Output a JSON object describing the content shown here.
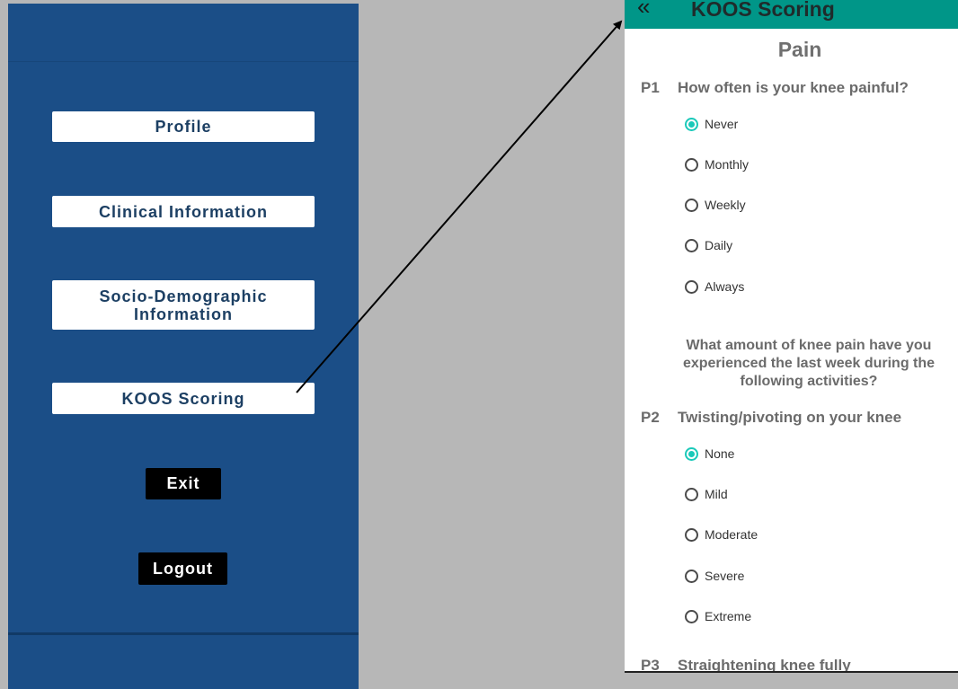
{
  "menu": {
    "profile": "Profile",
    "clinical": "Clinical Information",
    "socio_line1": "Socio-Demographic",
    "socio_line2": "Information",
    "koos": "KOOS Scoring",
    "exit": "Exit",
    "logout": "Logout"
  },
  "koos": {
    "back_icon": "«",
    "title": "KOOS Scoring",
    "section": "Pain",
    "p1": {
      "num": "P1",
      "question": "How often is your knee painful?",
      "options": [
        "Never",
        "Monthly",
        "Weekly",
        "Daily",
        "Always"
      ],
      "selected": "Never"
    },
    "instruction": "What amount of knee pain have you experienced the last week during the following activities?",
    "p2": {
      "num": "P2",
      "question": "Twisting/pivoting on your knee",
      "options": [
        "None",
        "Mild",
        "Moderate",
        "Severe",
        "Extreme"
      ],
      "selected": "None"
    },
    "p3": {
      "num": "P3",
      "question": "Straightening knee fully"
    }
  },
  "colors": {
    "menu_bg": "#1b4e87",
    "appbar": "#009688",
    "radio_accent": "#1ac9b9"
  }
}
